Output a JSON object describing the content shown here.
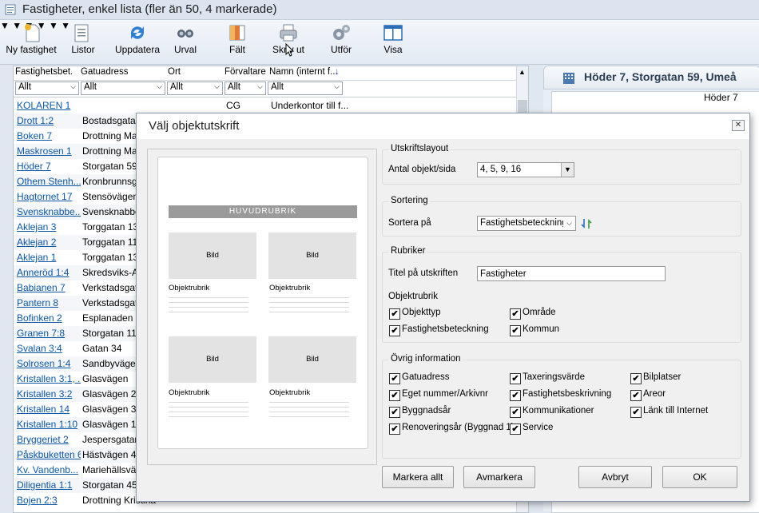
{
  "window": {
    "title": "Fastigheter, enkel lista  (fler än 50, 4 markerade)"
  },
  "toolbar": {
    "buttons": [
      {
        "label": "Ny fastighet",
        "icon": "new-document-icon"
      },
      {
        "label": "Listor",
        "icon": "list-icon"
      },
      {
        "label": "Uppdatera",
        "icon": "refresh-icon"
      },
      {
        "label": "Urval",
        "icon": "binoculars-icon"
      },
      {
        "label": "Fält",
        "icon": "columns-icon"
      },
      {
        "label": "Skriv ut",
        "icon": "printer-icon"
      },
      {
        "label": "Utför",
        "icon": "gears-icon"
      },
      {
        "label": "Visa",
        "icon": "window-icon"
      }
    ]
  },
  "grid": {
    "columns": [
      "Fastighetsbet.",
      "Gatuadress",
      "Ort",
      "Förvaltare",
      "Namn (internt f..."
    ],
    "filter_value": "Allt",
    "rows": [
      {
        "c1": "KOLAREN 1",
        "c2": "",
        "c4": "CG",
        "c5": "Underkontor till f..."
      },
      {
        "c1": "Drott 1:2",
        "c2": "Bostadsgatan",
        "c4": "",
        "c5": ""
      },
      {
        "c1": "Boken 7",
        "c2": "Drottning Marg",
        "c4": "",
        "c5": ""
      },
      {
        "c1": "Maskrosen 1",
        "c2": "Drottning Marg",
        "c4": "",
        "c5": ""
      },
      {
        "c1": "Höder 7",
        "c2": "Storgatan 59",
        "c4": "",
        "c5": ""
      },
      {
        "c1": "Othem Stenh...",
        "c2": "Kronbrunnsga",
        "c4": "",
        "c5": ""
      },
      {
        "c1": "Hagtornet 17",
        "c2": "Stensövägen",
        "c4": "",
        "c5": ""
      },
      {
        "c1": "Svensknabbe...",
        "c2": "Svensknabbe",
        "c4": "",
        "c5": ""
      },
      {
        "c1": "Aklejan 3",
        "c2": "Torggatan 13",
        "c4": "",
        "c5": ""
      },
      {
        "c1": "Aklejan 2",
        "c2": "Torggatan 11",
        "c4": "",
        "c5": ""
      },
      {
        "c1": "Aklejan 1",
        "c2": "Torggatan 13",
        "c4": "",
        "c5": ""
      },
      {
        "c1": "Anneröd 1:4",
        "c2": "Skredsviks-An",
        "c4": "",
        "c5": ""
      },
      {
        "c1": "Babianen 7",
        "c2": "Verkstadsgata",
        "c4": "",
        "c5": ""
      },
      {
        "c1": "Pantern 8",
        "c2": "Verkstadsgata",
        "c4": "",
        "c5": ""
      },
      {
        "c1": "Bofinken 2",
        "c2": "Esplanaden 8",
        "c4": "",
        "c5": ""
      },
      {
        "c1": "Granen 7:8",
        "c2": "Storgatan 11,",
        "c4": "",
        "c5": ""
      },
      {
        "c1": "Svalan 3:4",
        "c2": "Gatan 34",
        "c4": "",
        "c5": ""
      },
      {
        "c1": "Solrosen 1:4",
        "c2": "Sandbyvägen",
        "c4": "",
        "c5": ""
      },
      {
        "c1": "Kristallen 3:1, ...",
        "c2": "Glasvägen",
        "c4": "",
        "c5": ""
      },
      {
        "c1": "Kristallen 3:2",
        "c2": "Glasvägen 20",
        "c4": "",
        "c5": ""
      },
      {
        "c1": "Kristallen 14",
        "c2": "Glasvägen 30",
        "c4": "",
        "c5": ""
      },
      {
        "c1": "Kristallen 1:10",
        "c2": "Glasvägen 1 A",
        "c4": "",
        "c5": ""
      },
      {
        "c1": "Bryggeriet 2",
        "c2": "Jespersgatan",
        "c4": "",
        "c5": ""
      },
      {
        "c1": "Påskbuketten 6",
        "c2": "Hästvägen 4A",
        "c4": "",
        "c5": ""
      },
      {
        "c1": "Kv. Vandenb...",
        "c2": "Mariehällsväg",
        "c4": "",
        "c5": ""
      },
      {
        "c1": "Diligentia 1:1",
        "c2": "Storgatan 45",
        "c4": "",
        "c5": ""
      },
      {
        "c1": "Bojen 2:3",
        "c2": "Drottning Kristina",
        "c4": "",
        "c5": ""
      }
    ]
  },
  "right_panel": {
    "header": "Höder 7, Storgatan 59, Umeå",
    "field_value": "Höder 7"
  },
  "dialog": {
    "title": "Välj objektutskrift",
    "preview": {
      "banner": "HUVUDRUBRIK",
      "image_label": "Bild",
      "object_label": "Objektrubrik"
    },
    "layout_group": {
      "title": "Utskriftslayout",
      "label": "Antal objekt/sida",
      "value": "4, 5, 9, 16"
    },
    "sort_group": {
      "title": "Sortering",
      "label": "Sortera på",
      "value": "Fastighetsbeteckning"
    },
    "headings_group": {
      "title": "Rubriker",
      "title_label": "Titel på utskriften",
      "title_value": "Fastigheter",
      "object_heading_label": "Objektrubrik",
      "checkboxes": [
        {
          "label": "Objekttyp",
          "checked": true
        },
        {
          "label": "Område",
          "checked": true
        },
        {
          "label": "Fastighetsbeteckning",
          "checked": true
        },
        {
          "label": "Kommun",
          "checked": true
        }
      ]
    },
    "other_group": {
      "title": "Övrig information",
      "checkboxes": [
        {
          "label": "Gatuadress",
          "checked": true
        },
        {
          "label": "Taxeringsvärde",
          "checked": true
        },
        {
          "label": "Bilplatser",
          "checked": true
        },
        {
          "label": "Eget nummer/Arkivnr",
          "checked": true
        },
        {
          "label": "Fastighetsbeskrivning",
          "checked": true
        },
        {
          "label": "Areor",
          "checked": true
        },
        {
          "label": "Byggnadsår",
          "checked": true
        },
        {
          "label": "Kommunikationer",
          "checked": true
        },
        {
          "label": "Länk till Internet",
          "checked": true
        },
        {
          "label": "Renoveringsår (Byggnad 1)",
          "checked": true
        },
        {
          "label": "Service",
          "checked": true
        }
      ]
    },
    "buttons": {
      "select_all": "Markera allt",
      "deselect": "Avmarkera",
      "cancel": "Avbryt",
      "ok": "OK"
    },
    "check_mark": "✔"
  }
}
